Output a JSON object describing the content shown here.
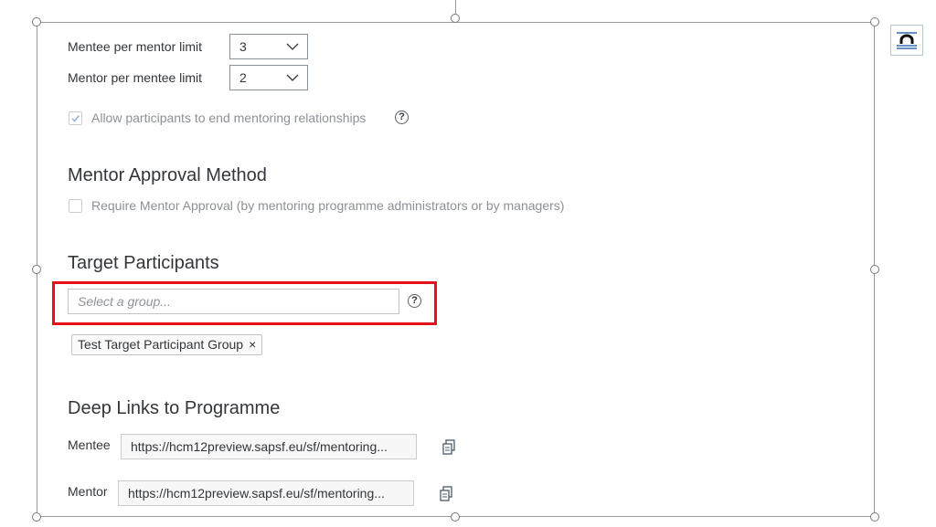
{
  "limits": {
    "mentee_per_mentor": {
      "label": "Mentee per mentor limit",
      "value": "3"
    },
    "mentor_per_mentee": {
      "label": "Mentor per mentee limit",
      "value": "2"
    }
  },
  "allow_end": {
    "label": "Allow participants to end mentoring relationships",
    "checked": true
  },
  "approval": {
    "heading": "Mentor Approval Method",
    "label": "Require Mentor Approval (by mentoring programme administrators or by managers)",
    "checked": false
  },
  "target": {
    "heading": "Target Participants",
    "placeholder": "Select a group...",
    "tokens": [
      "Test Target Participant Group"
    ],
    "token_remove": "×",
    "help": "?"
  },
  "deep_links": {
    "heading": "Deep Links to Programme",
    "mentee": {
      "label": "Mentee",
      "value": "https://hcm12preview.sapsf.eu/sf/mentoring..."
    },
    "mentor": {
      "label": "Mentor",
      "value": "https://hcm12preview.sapsf.eu/sf/mentoring..."
    }
  },
  "help_glyph": "?",
  "colors": {
    "highlight": "#e3121b",
    "text": "#32363a",
    "muted": "#8b9197",
    "frame": "#9a9a9a"
  },
  "icons": [
    "chevron-down-icon",
    "checkmark-icon",
    "help-icon",
    "copy-icon",
    "layout-options-icon"
  ]
}
